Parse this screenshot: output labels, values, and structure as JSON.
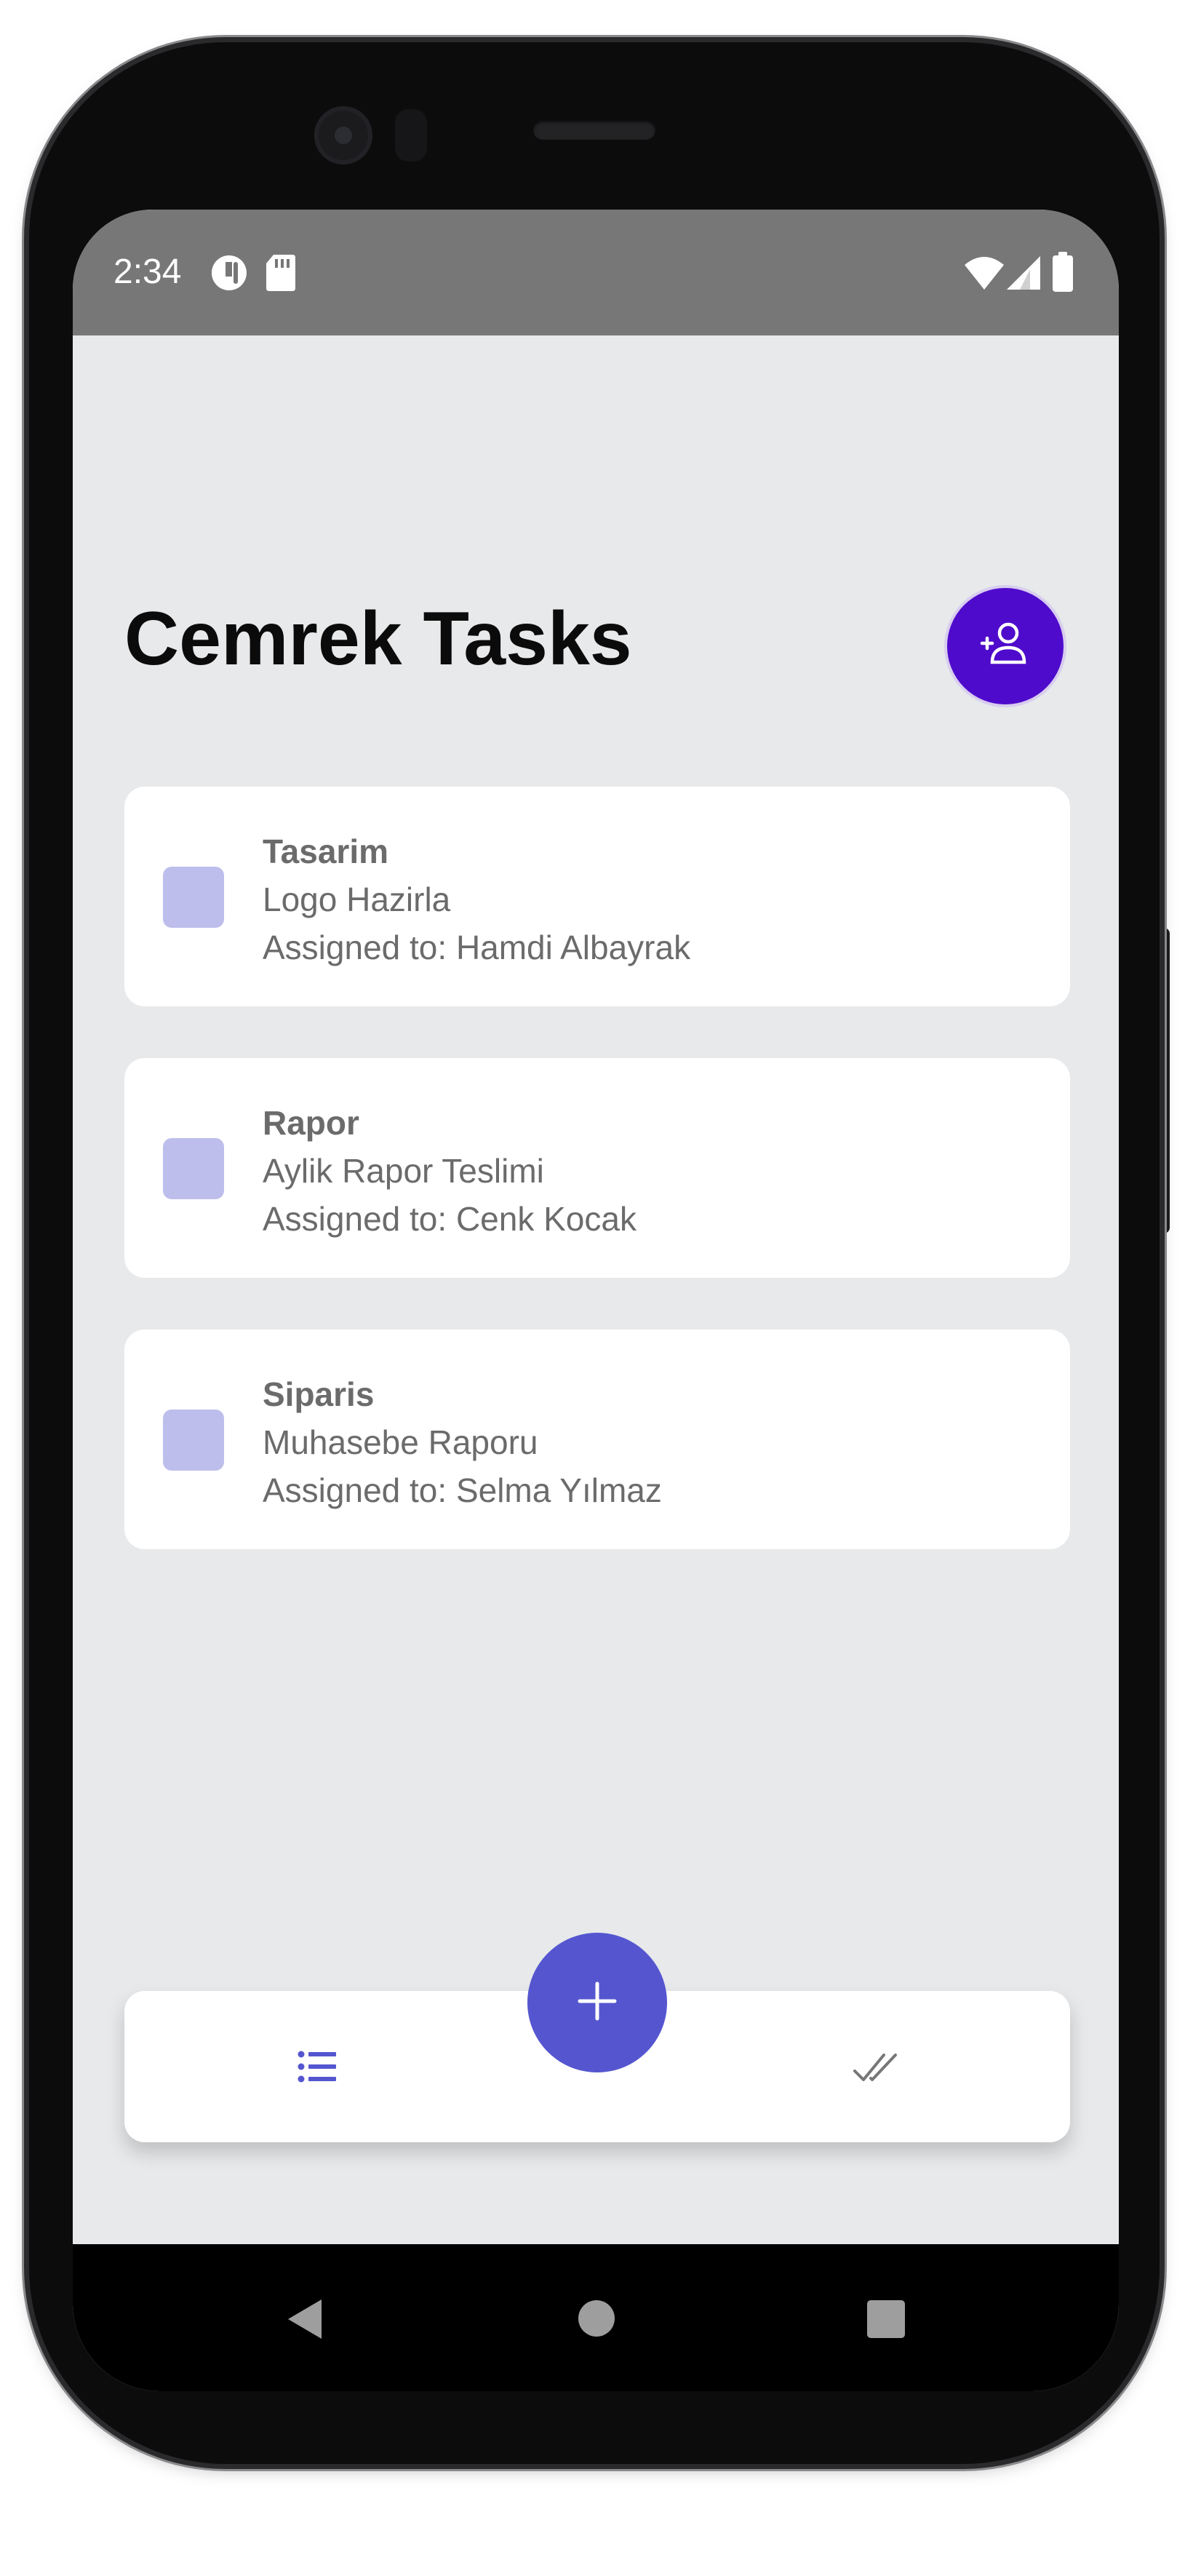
{
  "status_bar": {
    "time": "2:34",
    "icons": [
      "data-saver-icon",
      "sd-card-icon",
      "wifi-icon",
      "cell-signal-icon",
      "battery-icon"
    ]
  },
  "app": {
    "title": "Cemrek Tasks",
    "add_user_icon": "person-add-icon"
  },
  "tasks": [
    {
      "category": "Tasarim",
      "name": "Logo Hazirla",
      "assignee": "Assigned to: Hamdi Albayrak",
      "checked": false
    },
    {
      "category": "Rapor",
      "name": "Aylik Rapor Teslimi",
      "assignee": "Assigned to: Cenk Kocak",
      "checked": false
    },
    {
      "category": "Siparis",
      "name": "Muhasebe Raporu",
      "assignee": "Assigned to: Selma Yılmaz",
      "checked": false
    }
  ],
  "bottom_nav": {
    "items": [
      {
        "icon": "list-icon",
        "active": true
      },
      {
        "icon": "done-all-icon",
        "active": false
      }
    ],
    "fab_icon": "plus-icon"
  },
  "system_nav": {
    "keys": [
      "back-icon",
      "home-icon",
      "recents-icon"
    ]
  },
  "colors": {
    "accent": "#5556cf",
    "add_user_button": "#4f0bcb",
    "checkbox": "#bdbeec",
    "screen_background": "#e7e9eb",
    "status_bar": "#777777"
  }
}
